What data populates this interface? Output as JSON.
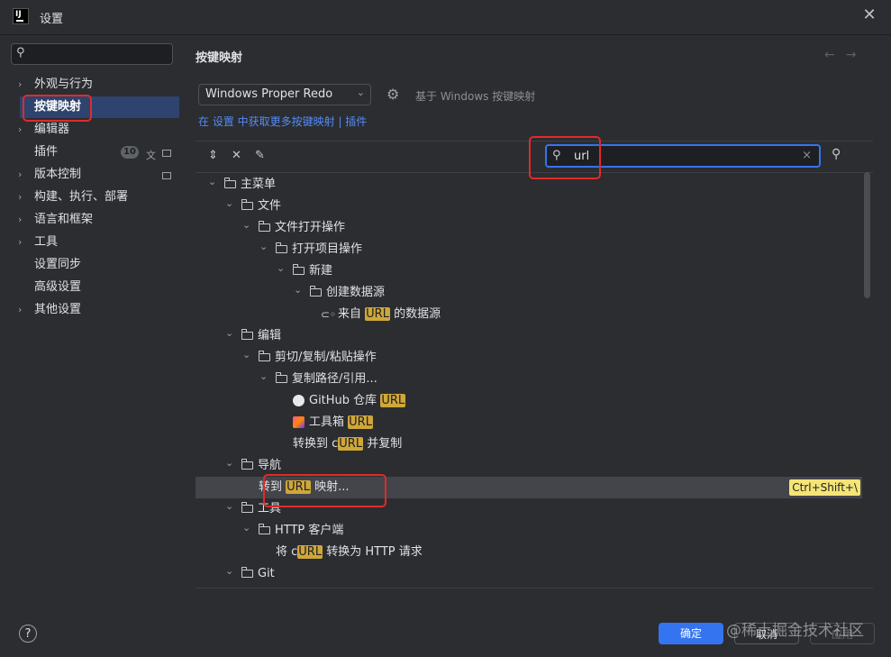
{
  "window": {
    "title": "设置",
    "close": "✕"
  },
  "sidebar": {
    "search_placeholder": "",
    "items": [
      {
        "label": "外观与行为",
        "expandable": true
      },
      {
        "label": "按键映射",
        "expandable": false,
        "selected": true
      },
      {
        "label": "编辑器",
        "expandable": true
      },
      {
        "label": "插件",
        "expandable": false,
        "badge": "10"
      },
      {
        "label": "版本控制",
        "expandable": true
      },
      {
        "label": "构建、执行、部署",
        "expandable": true
      },
      {
        "label": "语言和框架",
        "expandable": true
      },
      {
        "label": "工具",
        "expandable": true
      },
      {
        "label": "设置同步",
        "expandable": false
      },
      {
        "label": "高级设置",
        "expandable": false
      },
      {
        "label": "其他设置",
        "expandable": true
      }
    ]
  },
  "main": {
    "title": "按键映射",
    "keymap_select": "Windows Proper Redo",
    "based_on": "基于 Windows 按键映射",
    "link_line": "在 设置 中获取更多按键映射 | 插件",
    "filter_value": "url"
  },
  "tree": [
    {
      "depth": 0,
      "icon": "menu-folder",
      "expanded": true,
      "parts": [
        "主菜单"
      ]
    },
    {
      "depth": 1,
      "icon": "folder",
      "expanded": true,
      "parts": [
        "文件"
      ]
    },
    {
      "depth": 2,
      "icon": "folder",
      "expanded": true,
      "parts": [
        "文件打开操作"
      ]
    },
    {
      "depth": 3,
      "icon": "folder",
      "expanded": true,
      "parts": [
        "打开项目操作"
      ]
    },
    {
      "depth": 4,
      "icon": "folder",
      "expanded": true,
      "parts": [
        "新建"
      ]
    },
    {
      "depth": 5,
      "icon": "folder",
      "expanded": true,
      "parts": [
        "创建数据源"
      ]
    },
    {
      "depth": 6,
      "icon": "plug",
      "parts": [
        "来自 ",
        "URL",
        " 的数据源"
      ]
    },
    {
      "depth": 1,
      "icon": "folder",
      "expanded": true,
      "parts": [
        "编辑"
      ]
    },
    {
      "depth": 2,
      "icon": "folder",
      "expanded": true,
      "parts": [
        "剪切/复制/粘贴操作"
      ]
    },
    {
      "depth": 3,
      "icon": "folder",
      "expanded": true,
      "parts": [
        "复制路径/引用..."
      ]
    },
    {
      "depth": 4,
      "icon": "github",
      "parts": [
        "GitHub 仓库 ",
        "URL",
        ""
      ]
    },
    {
      "depth": 4,
      "icon": "toolbox",
      "parts": [
        "工具箱 ",
        "URL",
        ""
      ]
    },
    {
      "depth": 4,
      "icon": "none",
      "parts": [
        "转换到 c",
        "URL",
        " 并复制"
      ]
    },
    {
      "depth": 1,
      "icon": "folder",
      "expanded": true,
      "parts": [
        "导航"
      ]
    },
    {
      "depth": 2,
      "icon": "none",
      "parts": [
        "转到 ",
        "URL",
        " 映射..."
      ],
      "selected": true,
      "shortcut": "Ctrl+Shift+\\"
    },
    {
      "depth": 1,
      "icon": "folder",
      "expanded": true,
      "parts": [
        "工具"
      ]
    },
    {
      "depth": 2,
      "icon": "folder",
      "expanded": true,
      "parts": [
        "HTTP 客户端"
      ]
    },
    {
      "depth": 3,
      "icon": "none",
      "parts": [
        "将 c",
        "URL",
        " 转换为 HTTP 请求"
      ]
    },
    {
      "depth": 1,
      "icon": "folder",
      "expanded": true,
      "parts": [
        "Git"
      ]
    }
  ],
  "buttons": {
    "ok": "确定",
    "cancel": "取消",
    "apply": "应用",
    "help": "?"
  },
  "watermark": "@稀土掘金技术社区",
  "colors": {
    "accent": "#3574f0",
    "highlight": "#cfa739",
    "annotation": "#e22a2a"
  }
}
